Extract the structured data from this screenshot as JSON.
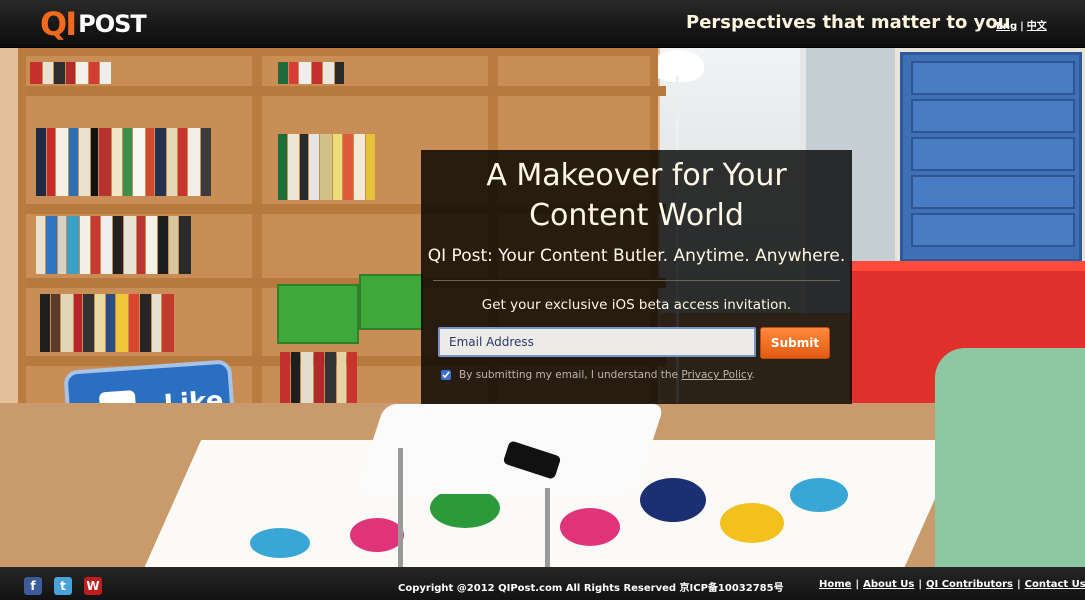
{
  "header": {
    "logo_qi": "QI",
    "logo_post": "POST",
    "tagline": "Perspectives that matter to you",
    "lang_eng": "Eng",
    "lang_sep": "|",
    "lang_zh": "中文"
  },
  "hero": {
    "headline_line1": "A Makeover for Your",
    "headline_line2": "Content World",
    "subhead": "QI Post: Your Content Butler. Anytime. Anywhere.",
    "invite": "Get your exclusive iOS beta access invitation.",
    "email_value": "Email Address",
    "submit_label": "Submit",
    "agree_prefix": "By submitting my email, I understand the ",
    "privacy_link": "Privacy Policy",
    "agree_suffix": ".",
    "agree_checked": true
  },
  "scene": {
    "pillow_text": "Like"
  },
  "footer": {
    "social": [
      {
        "icon": "facebook-icon",
        "glyph": "f"
      },
      {
        "icon": "twitter-icon",
        "glyph": "t"
      },
      {
        "icon": "weibo-icon",
        "glyph": "W"
      }
    ],
    "copyright": "Copyright @2012 QIPost.com All Rights Reserved 京ICP备10032785号",
    "links": [
      "Home",
      "About Us",
      "QI Contributors",
      "Contact Us"
    ],
    "link_sep": "|"
  },
  "colors": {
    "accent_orange": "#f26a1b",
    "submit_orange": "#e25b12",
    "panel_bg": "rgba(0,0,0,0.80)"
  }
}
